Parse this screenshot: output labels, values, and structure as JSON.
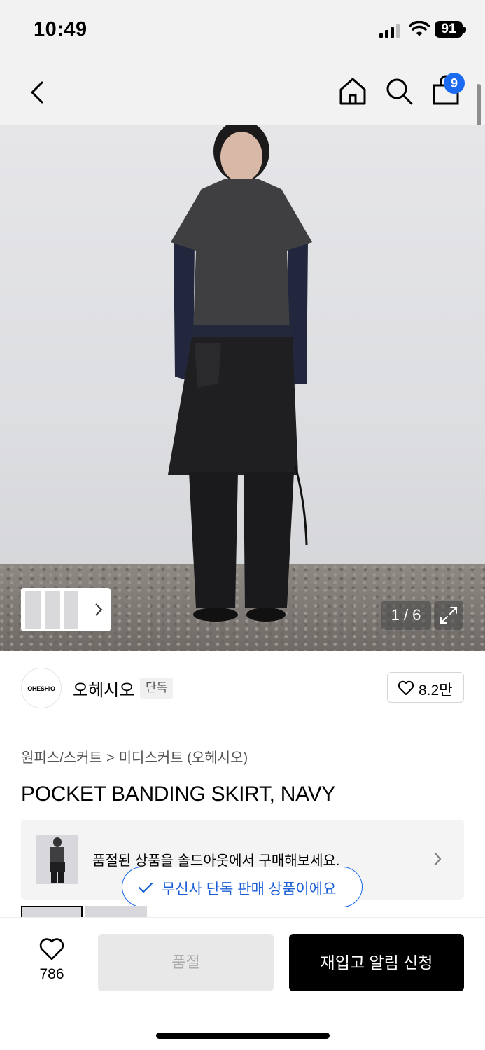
{
  "status_bar": {
    "time": "10:49",
    "battery": "91"
  },
  "nav": {
    "cart_count": "9"
  },
  "gallery": {
    "counter": "1 / 6"
  },
  "brand": {
    "logo_text": "OHESHIO",
    "name": "오헤시오",
    "exclusive_tag": "단독",
    "likes": "8.2만"
  },
  "breadcrumb": {
    "category": "원피스/스커트",
    "separator": ">",
    "subcategory": "미디스커트 (오헤시오)"
  },
  "product": {
    "title": "POCKET BANDING SKIRT, NAVY"
  },
  "soldout_banner": {
    "text": "품절된 상품을 솔드아웃에서 구매해보세요."
  },
  "toast": {
    "text": "무신사 단독 판매 상품이에요"
  },
  "bottom_bar": {
    "wish_count": "786",
    "soldout_label": "품절",
    "restock_label": "재입고 알림 신청"
  },
  "colors": {
    "accent": "#1a6bf0",
    "primary_button": "#000000",
    "disabled_button": "#e8e8e8"
  }
}
